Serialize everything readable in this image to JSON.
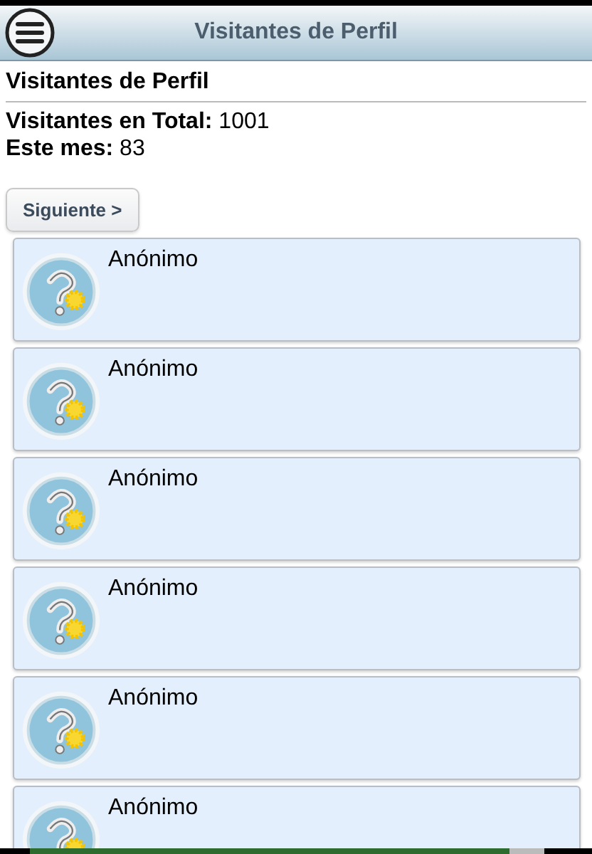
{
  "header": {
    "title": "Visitantes de Perfil"
  },
  "section_title": "Visitantes de Perfil",
  "stats": [
    {
      "label": "Visitantes en Total:",
      "value": "1001"
    },
    {
      "label": "Este mes:",
      "value": "83"
    }
  ],
  "next_button": "Siguiente >",
  "visitors": [
    {
      "name": "Anónimo"
    },
    {
      "name": "Anónimo"
    },
    {
      "name": "Anónimo"
    },
    {
      "name": "Anónimo"
    },
    {
      "name": "Anónimo"
    },
    {
      "name": "Anónimo"
    }
  ]
}
